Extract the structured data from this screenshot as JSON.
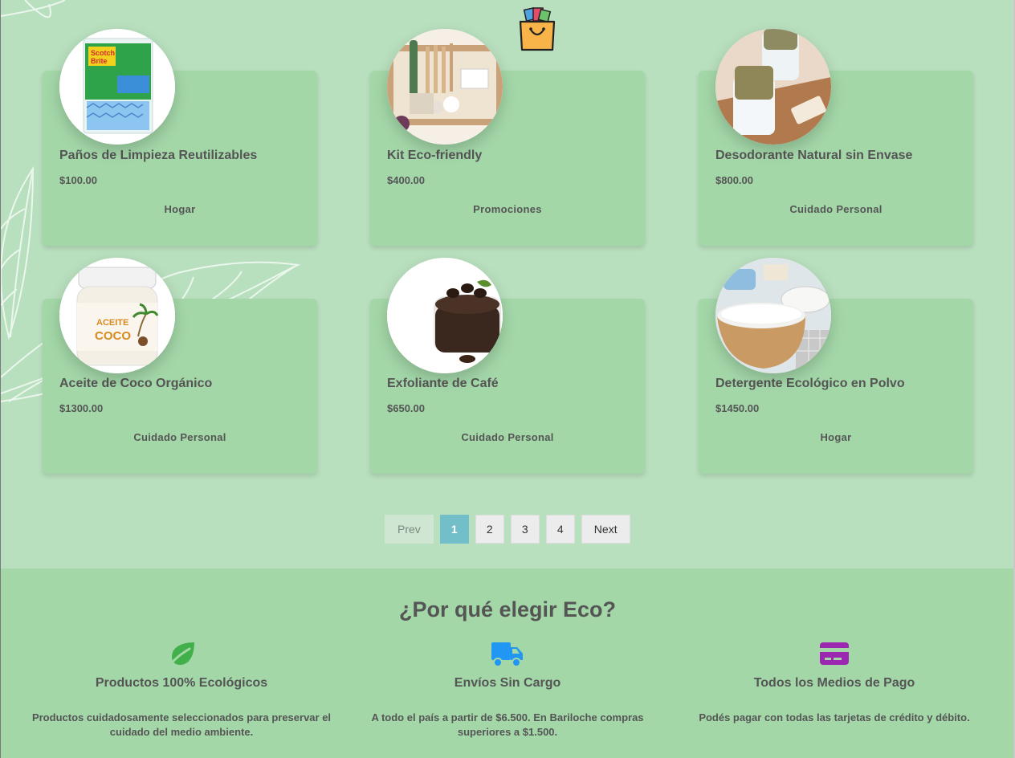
{
  "products": [
    {
      "name": "Paños de Limpieza Reutilizables",
      "price": "$100.00",
      "category": "Hogar"
    },
    {
      "name": "Kit Eco-friendly",
      "price": "$400.00",
      "category": "Promociones"
    },
    {
      "name": "Desodorante Natural sin Envase",
      "price": "$800.00",
      "category": "Cuidado Personal"
    },
    {
      "name": "Aceite de Coco Orgánico",
      "price": "$1300.00",
      "category": "Cuidado Personal"
    },
    {
      "name": "Exfoliante de Café",
      "price": "$650.00",
      "category": "Cuidado Personal"
    },
    {
      "name": "Detergente Ecológico en Polvo",
      "price": "$1450.00",
      "category": "Hogar"
    }
  ],
  "pagination": {
    "prev": "Prev",
    "pages": [
      "1",
      "2",
      "3",
      "4"
    ],
    "active": "1",
    "next": "Next"
  },
  "why": {
    "title": "¿Por qué elegir Eco?",
    "features": [
      {
        "icon": "leaf-icon",
        "title": "Productos 100% Ecológicos",
        "text": "Productos cuidadosamente seleccionados para preservar el cuidado del medio ambiente."
      },
      {
        "icon": "truck-icon",
        "title": "Envíos Sin Cargo",
        "text": "A todo el país a partir de $6.500. En Bariloche compras superiores a $1.500."
      },
      {
        "icon": "credit-card-icon",
        "title": "Todos los Medios de Pago",
        "text": "Podés pagar con todas las tarjetas de crédito y débito."
      }
    ]
  },
  "colors": {
    "background": "#b8dfbe",
    "card": "#a3d7a8",
    "active_page": "#72bfc9",
    "leaf": "#41b04b",
    "truck": "#2196f3",
    "card_icon": "#9c27b0"
  }
}
